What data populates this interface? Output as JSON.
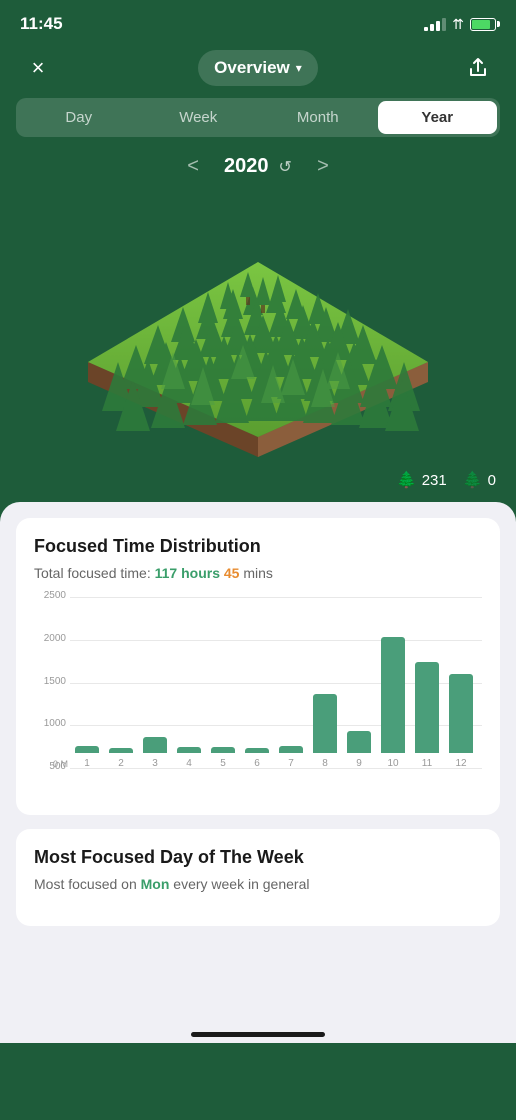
{
  "statusBar": {
    "time": "11:45"
  },
  "topNav": {
    "closeLabel": "×",
    "title": "Overview",
    "chevron": "∨",
    "shareLabel": "↑"
  },
  "periodTabs": {
    "items": [
      "Day",
      "Week",
      "Month",
      "Year"
    ],
    "activeIndex": 3
  },
  "yearNav": {
    "year": "2020",
    "leftArrow": "<",
    "rightArrow": ">"
  },
  "stats": {
    "trees": "231",
    "dead": "0"
  },
  "focusedTimeCard": {
    "title": "Focused Time Distribution",
    "subtitlePrefix": "Total focused time: ",
    "hours": "117",
    "hoursLabel": " hours ",
    "mins": "45",
    "minsLabel": " mins",
    "chartData": {
      "yLabels": [
        "2500",
        "2000",
        "1500",
        "1000",
        "500",
        "0 M"
      ],
      "maxValue": 2500,
      "bars": [
        {
          "month": "1",
          "value": 120
        },
        {
          "month": "2",
          "value": 90
        },
        {
          "month": "3",
          "value": 280
        },
        {
          "month": "4",
          "value": 100
        },
        {
          "month": "5",
          "value": 110
        },
        {
          "month": "6",
          "value": 90
        },
        {
          "month": "7",
          "value": 130
        },
        {
          "month": "8",
          "value": 1020
        },
        {
          "month": "9",
          "value": 380
        },
        {
          "month": "10",
          "value": 2020
        },
        {
          "month": "11",
          "value": 1580
        },
        {
          "month": "12",
          "value": 1380
        }
      ]
    }
  },
  "mostFocusedCard": {
    "title": "Most Focused Day of The Week",
    "subtitlePrefix": "Most focused on ",
    "day": "Mon",
    "subtitleSuffix": " every week in general"
  }
}
